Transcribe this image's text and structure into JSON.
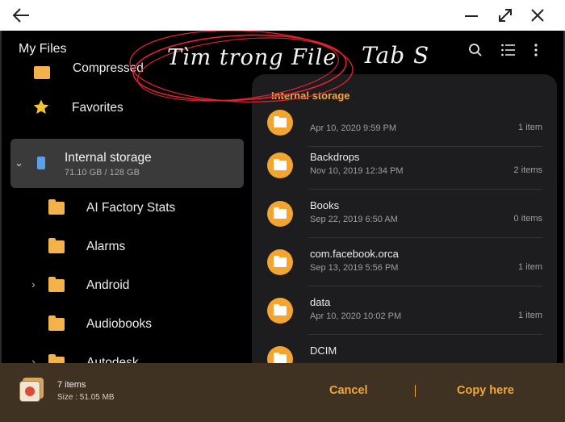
{
  "app": {
    "title": "My Files"
  },
  "annotation": {
    "handwritten": "Tìm trong File",
    "device": "Tab S",
    "ink_color": "#e0242f"
  },
  "colors": {
    "accent": "#f2a836",
    "folder": "#f3a431",
    "selected_bg": "#3a3a3a"
  },
  "nav": {
    "items": [
      {
        "label": "Compressed",
        "icon": "folder-icon"
      },
      {
        "label": "Favorites",
        "icon": "star-icon"
      },
      {
        "label": "Internal storage",
        "sub": "71.10 GB / 128 GB",
        "icon": "phone-icon",
        "selected": true
      },
      {
        "label": "AI Factory Stats",
        "icon": "folder-icon"
      },
      {
        "label": "Alarms",
        "icon": "folder-icon"
      },
      {
        "label": "Android",
        "icon": "folder-icon",
        "expandable": true
      },
      {
        "label": "Audiobooks",
        "icon": "folder-icon"
      },
      {
        "label": "Autodesk",
        "icon": "folder-icon",
        "expandable": true
      }
    ]
  },
  "panel": {
    "header": "Internal storage",
    "rows": [
      {
        "name": "",
        "date": "Apr 10, 2020 9:59 PM",
        "count": "1 item"
      },
      {
        "name": "Backdrops",
        "date": "Nov 10, 2019 12:34 PM",
        "count": "2 items"
      },
      {
        "name": "Books",
        "date": "Sep 22, 2019 6:50 AM",
        "count": "0 items"
      },
      {
        "name": "com.facebook.orca",
        "date": "Sep 13, 2019 5:56 PM",
        "count": "1 item"
      },
      {
        "name": "data",
        "date": "Apr 10, 2020 10:02 PM",
        "count": "1 item"
      },
      {
        "name": "DCIM",
        "date": "",
        "count": ""
      }
    ]
  },
  "bottom": {
    "count": "7 items",
    "size": "Size : 51.05 MB",
    "cancel": "Cancel",
    "copy": "Copy here"
  }
}
